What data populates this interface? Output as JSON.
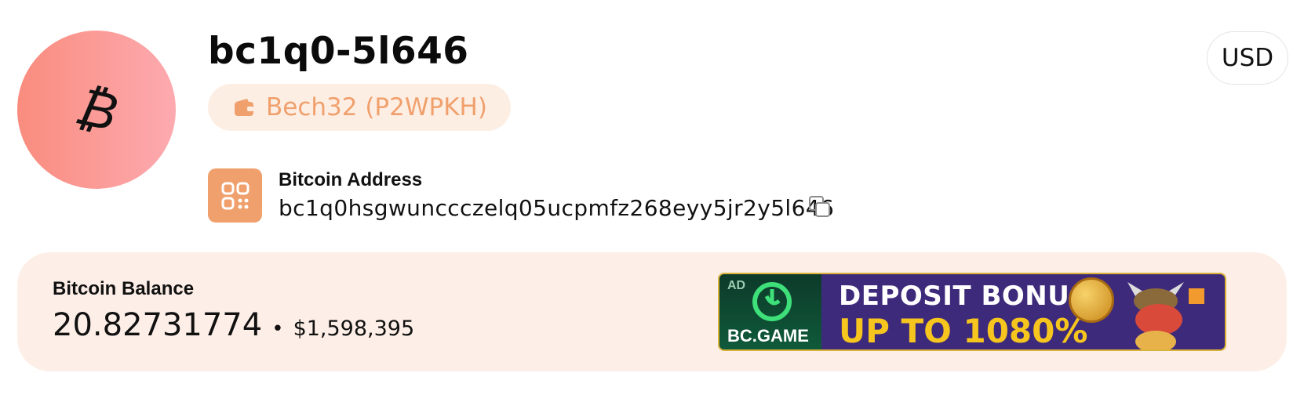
{
  "header": {
    "short_address": "bc1q0-5l646",
    "address_type": "Bech32 (P2WPKH)",
    "currency": "USD",
    "avatar_icon": "bitcoin-icon",
    "type_icon": "wallet-icon"
  },
  "address": {
    "label": "Bitcoin Address",
    "value": "bc1q0hsgwunccczelq05ucpmfz268eyy5jr2y5l646",
    "qr_icon": "qr-code-icon",
    "copy_icon": "copy-icon"
  },
  "balance": {
    "label": "Bitcoin Balance",
    "btc": "20.82731774",
    "separator": "•",
    "usd": "$1,598,395"
  },
  "ad": {
    "badge": "AD",
    "brand": "BC.GAME",
    "title": "DEPOSIT BONUS",
    "subtitle": "UP TO 1080%"
  },
  "colors": {
    "accent": "#f0a06c",
    "pill_bg": "#fdeee4",
    "card_bg": "#fdefe7",
    "avatar_gradient_start": "#f98c7e",
    "avatar_gradient_end": "#fdaab0"
  }
}
